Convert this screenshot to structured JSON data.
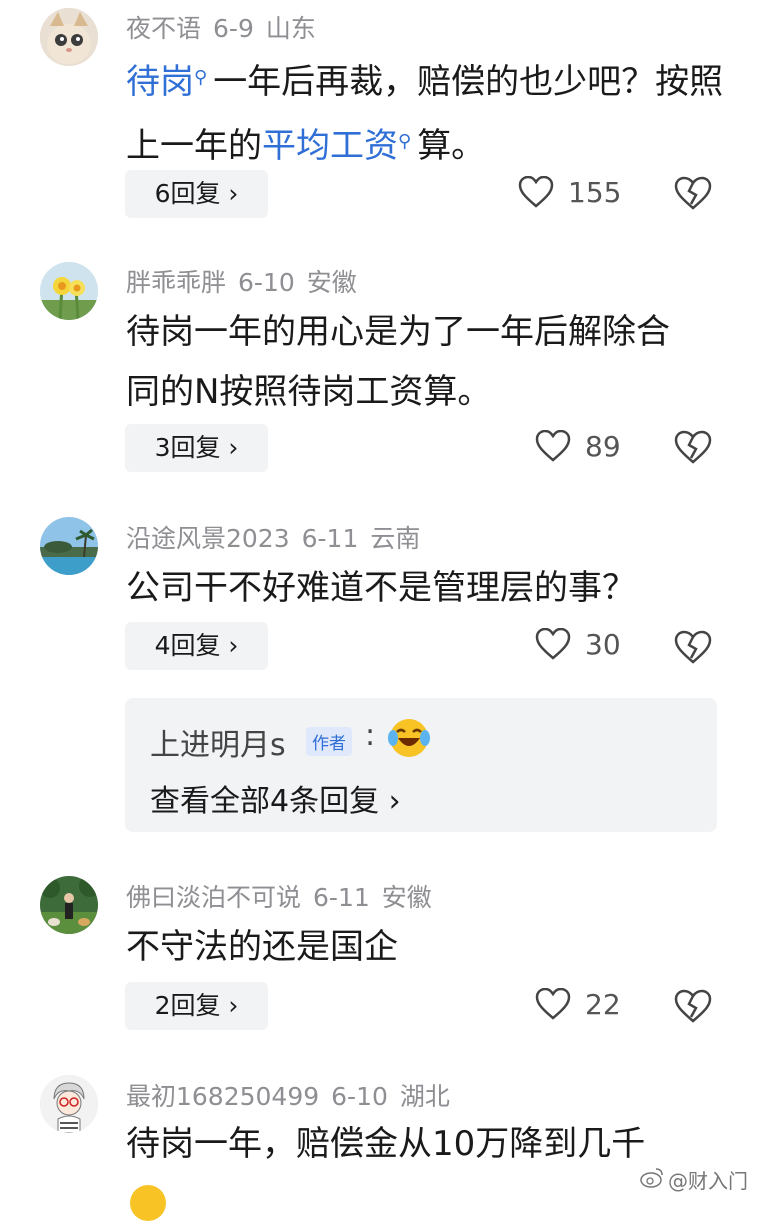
{
  "comments": [
    {
      "username": "夜不语",
      "date": "6-9",
      "location": "山东",
      "text_parts": [
        "待岗",
        "一年后再裁，赔偿的也少吧？按照上一年的",
        "平均工资",
        "算。"
      ],
      "reply_label": "6回复",
      "likes": "155"
    },
    {
      "username": "胖乖乖胖",
      "date": "6-10",
      "location": "安徽",
      "text": "待岗一年的用心是为了一年后解除合同的N按照待岗工资算。",
      "reply_label": "3回复",
      "likes": "89"
    },
    {
      "username": "沿途风景2023",
      "date": "6-11",
      "location": "云南",
      "text": "公司干不好难道不是管理层的事？",
      "reply_label": "4回复",
      "likes": "30",
      "preview": {
        "reply_user": "上进明月s",
        "author_badge": "作者",
        "colon": ":",
        "view_all": "查看全部4条回复 ›"
      }
    },
    {
      "username": "佛曰淡泊不可说",
      "date": "6-11",
      "location": "安徽",
      "text": "不守法的还是国企",
      "reply_label": "2回复",
      "likes": "22"
    },
    {
      "username": "最初168250499",
      "date": "6-10",
      "location": "湖北",
      "text": "待岗一年，赔偿金从10万降到几千"
    }
  ],
  "icons": {
    "search": "search-icon",
    "like": "heart-icon",
    "dislike": "broken-heart-icon",
    "chevron": "chevron-right-icon"
  },
  "watermark": "@财入门",
  "colors": {
    "link": "#2f6fd6",
    "meta": "#8e8e93",
    "button_bg": "#f2f3f5"
  }
}
